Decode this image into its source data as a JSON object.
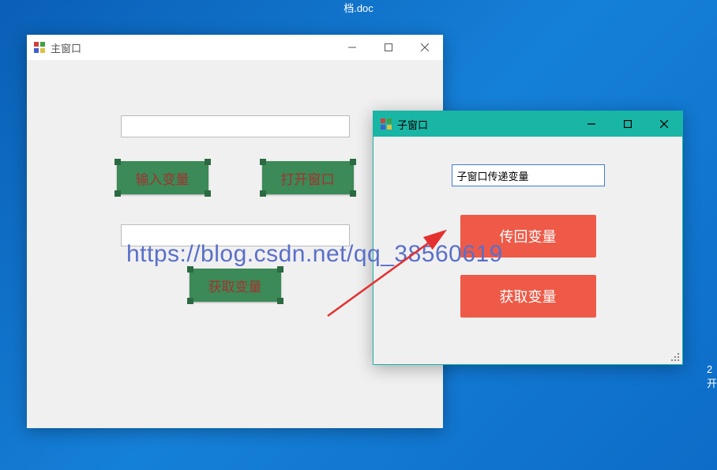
{
  "desktop": {
    "file_label": "档.doc"
  },
  "mainWindow": {
    "title": "主窗口",
    "input1_value": "",
    "btn_input_var": "输入变量",
    "btn_open_window": "打开窗口",
    "input2_value": "",
    "btn_get_var": "获取变量"
  },
  "childWindow": {
    "title": "子窗口",
    "input_value": "子窗口传递变量",
    "btn_return_var": "传回变量",
    "btn_get_var": "获取变量"
  },
  "watermark": "https://blog.csdn.net/qq_38560619",
  "side": {
    "line1": "2",
    "line2": "开"
  }
}
